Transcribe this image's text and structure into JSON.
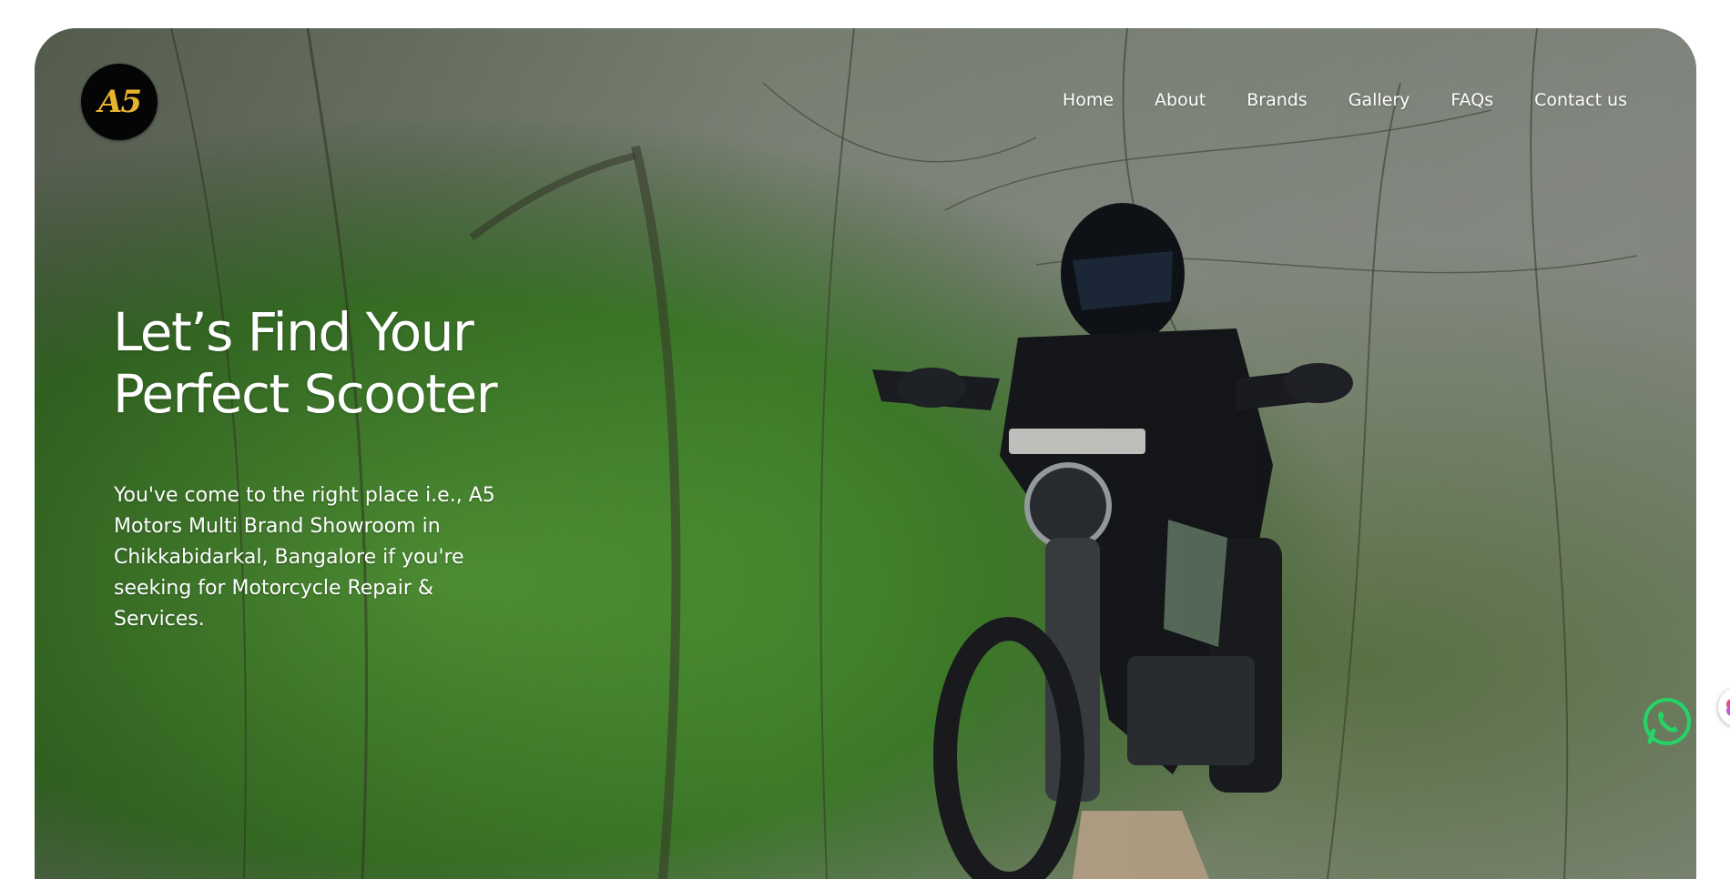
{
  "logo": {
    "text": "A5",
    "colors": {
      "background": "#050505",
      "mark": "#e7b22f"
    }
  },
  "nav": {
    "items": [
      {
        "label": "Home"
      },
      {
        "label": "About"
      },
      {
        "label": "Brands"
      },
      {
        "label": "Gallery"
      },
      {
        "label": "FAQs"
      },
      {
        "label": "Contact us"
      }
    ]
  },
  "hero": {
    "headline_line1": "Let’s Find Your",
    "headline_line2": "Perfect Scooter",
    "subtext": "You've come to the right place i.e., A5 Motors Multi Brand Showroom in Chikkabidarkal, Bangalore if you're seeking for Motorcycle Repair & Services.",
    "background_image": "motorcycle-rider-forest-photo"
  },
  "widgets": {
    "whatsapp_icon": "whatsapp-icon",
    "whatsapp_color": "#25d366",
    "side_widget_icon": "brain-icon"
  }
}
